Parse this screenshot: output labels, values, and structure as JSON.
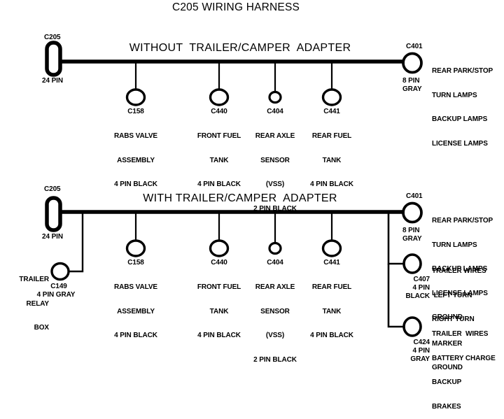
{
  "page": {
    "title": "C205 WIRING HARNESS",
    "background": "#ffffff",
    "line_color": "#000000"
  },
  "sections": [
    {
      "id": "without-adapter",
      "heading": "WITHOUT  TRAILER/CAMPER  ADAPTER",
      "source_connector": {
        "id": "C205",
        "pins": "24 PIN",
        "shape": "rounded-rectangle"
      },
      "end_connector": {
        "id": "C401",
        "pins": "8 PIN",
        "color": "GRAY",
        "functions": [
          "REAR PARK/STOP",
          "TURN LAMPS",
          "BACKUP LAMPS",
          "LICENSE LAMPS"
        ]
      },
      "drops": [
        {
          "id": "C158",
          "lines": [
            "RABS VALVE",
            "ASSEMBLY",
            "4 PIN BLACK"
          ]
        },
        {
          "id": "C440",
          "lines": [
            "FRONT FUEL",
            "TANK",
            "4 PIN BLACK"
          ]
        },
        {
          "id": "C404",
          "lines": [
            "REAR AXLE",
            "SENSOR",
            "(VSS)",
            "2 PIN BLACK"
          ]
        },
        {
          "id": "C441",
          "lines": [
            "REAR FUEL",
            "TANK",
            "4 PIN BLACK"
          ]
        }
      ]
    },
    {
      "id": "with-adapter",
      "heading": "WITH TRAILER/CAMPER  ADAPTER",
      "source_connector": {
        "id": "C205",
        "pins": "24 PIN",
        "shape": "rounded-rectangle"
      },
      "end_connector": {
        "id": "C401",
        "pins": "8 PIN",
        "color": "GRAY",
        "functions": [
          "REAR PARK/STOP",
          "TURN LAMPS",
          "BACKUP LAMPS",
          "LICENSE LAMPS",
          "GROUND"
        ]
      },
      "drops": [
        {
          "id": "C158",
          "lines": [
            "RABS VALVE",
            "ASSEMBLY",
            "4 PIN BLACK"
          ]
        },
        {
          "id": "C440",
          "lines": [
            "FRONT FUEL",
            "TANK",
            "4 PIN BLACK"
          ]
        },
        {
          "id": "C404",
          "lines": [
            "REAR AXLE",
            "SENSOR",
            "(VSS)",
            "2 PIN BLACK"
          ]
        },
        {
          "id": "C441",
          "lines": [
            "REAR FUEL",
            "TANK",
            "4 PIN BLACK"
          ]
        }
      ],
      "trailer_relay": {
        "name_lines": [
          "TRAILER",
          "RELAY",
          "BOX"
        ],
        "id": "C149",
        "spec": "4 PIN GRAY"
      },
      "trailer_connectors": [
        {
          "id": "C407",
          "pins": "4 PIN",
          "color": "BLACK",
          "functions": [
            "TRAILER WIRES",
            " LEFT TURN",
            "RIGHT TURN",
            "MARKER",
            "GROUND"
          ]
        },
        {
          "id": "C424",
          "pins": "4 PIN",
          "color": "GRAY",
          "functions": [
            "TRAILER  WIRES",
            "BATTERY CHARGE",
            "BACKUP",
            "BRAKES"
          ]
        }
      ]
    }
  ]
}
